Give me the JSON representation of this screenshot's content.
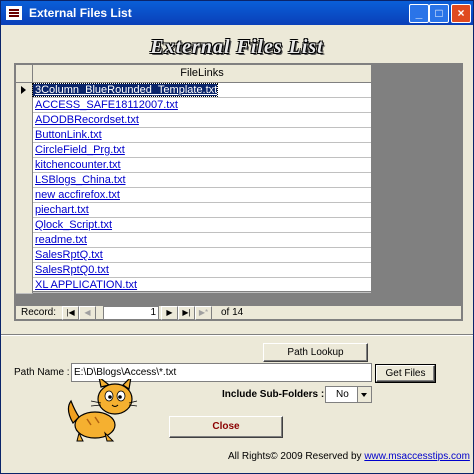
{
  "window": {
    "title": "External Files List"
  },
  "header": {
    "title": "External Files List"
  },
  "grid": {
    "column_header": "FileLinks",
    "rows": [
      "3Column_BlueRounded_Template.txt",
      "ACCESS_SAFE18112007.txt",
      "ADODBRecordset.txt",
      "ButtonLink.txt",
      "CircleField_Prg.txt",
      "kitchencounter.txt",
      "LSBlogs_China.txt",
      "new accfirefox.txt",
      "piechart.txt",
      "Qlock_Script.txt",
      "readme.txt",
      "SalesRptQ.txt",
      "SalesRptQ0.txt",
      "XL APPLICATION.txt"
    ],
    "current_row": 0
  },
  "navigation": {
    "label": "Record:",
    "current": "1",
    "of_text": "of  14"
  },
  "buttons": {
    "path_lookup": "Path Lookup",
    "get_files": "Get Files",
    "close": "Close"
  },
  "path": {
    "label": "Path Name :",
    "value": "E:\\D\\Blogs\\Access\\*.txt"
  },
  "subfolders": {
    "label": "Include Sub-Folders :",
    "value": "No"
  },
  "footer": {
    "rights": "All Rights©  2009   Reserved by",
    "link": "www.msaccesstips.com"
  }
}
